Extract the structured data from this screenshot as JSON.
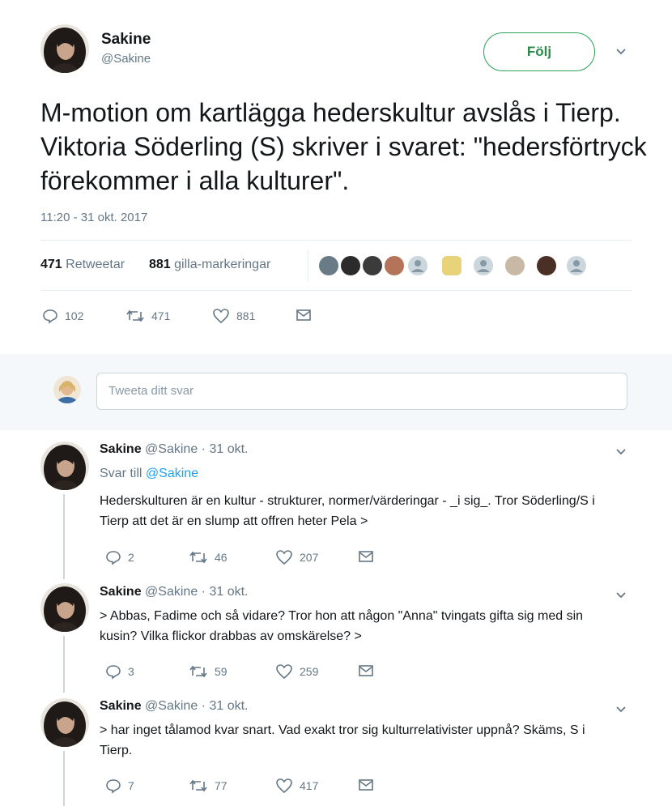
{
  "tweet": {
    "author_name": "Sakine",
    "author_handle": "@Sakine",
    "follow_label": "Följ",
    "text": "M-motion om kartlägga hederskultur avslås i Tierp. Viktoria Söderling (S) skriver i svaret: \"hedersförtryck förekommer i alla kulturer\".",
    "timestamp": "11:20 - 31 okt. 2017",
    "stats": {
      "retweets_count": "471",
      "retweets_label": "Retweetar",
      "likes_count": "881",
      "likes_label": "gilla-markeringar"
    },
    "actions": {
      "replies": "102",
      "retweets": "471",
      "likes": "881"
    }
  },
  "reply_box": {
    "placeholder": "Tweeta ditt svar"
  },
  "replies": [
    {
      "name": "Sakine",
      "handle": "@Sakine",
      "date": "· 31 okt.",
      "reply_to_prefix": "Svar till",
      "reply_to_handle": "@Sakine",
      "text": "Hederskulturen är en kultur - strukturer, normer/värderingar - _i sig_. Tror Söderling/S i Tierp att det är en slump att offren heter Pela >",
      "replies": "2",
      "retweets": "46",
      "likes": "207"
    },
    {
      "name": "Sakine",
      "handle": "@Sakine",
      "date": "· 31 okt.",
      "text": "> Abbas, Fadime och så vidare? Tror hon att någon \"Anna\" tvingats gifta sig med sin kusin? Vilka flickor drabbas av omskärelse? >",
      "replies": "3",
      "retweets": "59",
      "likes": "259"
    },
    {
      "name": "Sakine",
      "handle": "@Sakine",
      "date": "· 31 okt.",
      "text": "> har inget tålamod kvar snart. Vad exakt tror sig kulturrelativister uppnå? Skäms, S i Tierp.",
      "replies": "7",
      "retweets": "77",
      "likes": "417"
    }
  ],
  "colors": {
    "accent": "#1da1f2",
    "follow_border": "#2aa154",
    "muted": "#657786"
  }
}
